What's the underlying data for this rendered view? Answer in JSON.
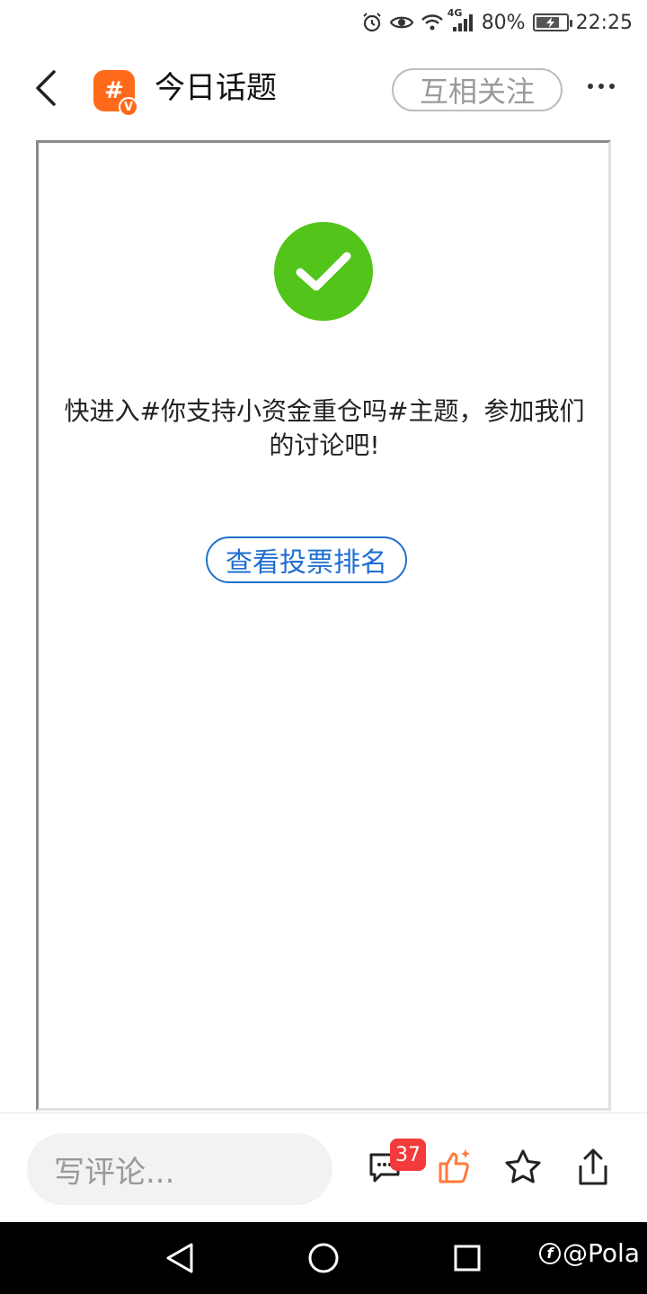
{
  "status_bar": {
    "network": "4G",
    "battery": "80%",
    "battery_level": 0.8,
    "time": "22:25"
  },
  "header": {
    "title": "今日话题",
    "logo_text": "#",
    "logo_badge": "V",
    "follow_label": "互相关注"
  },
  "content": {
    "message": "快进入#你支持小资金重仓吗#主题，参加我们的讨论吧!",
    "vote_rank_label": "查看投票排名",
    "success_color": "#52c41a"
  },
  "bottom_bar": {
    "comment_placeholder": "写评论...",
    "comment_count": "37"
  },
  "watermark": {
    "text": "@Pola"
  }
}
